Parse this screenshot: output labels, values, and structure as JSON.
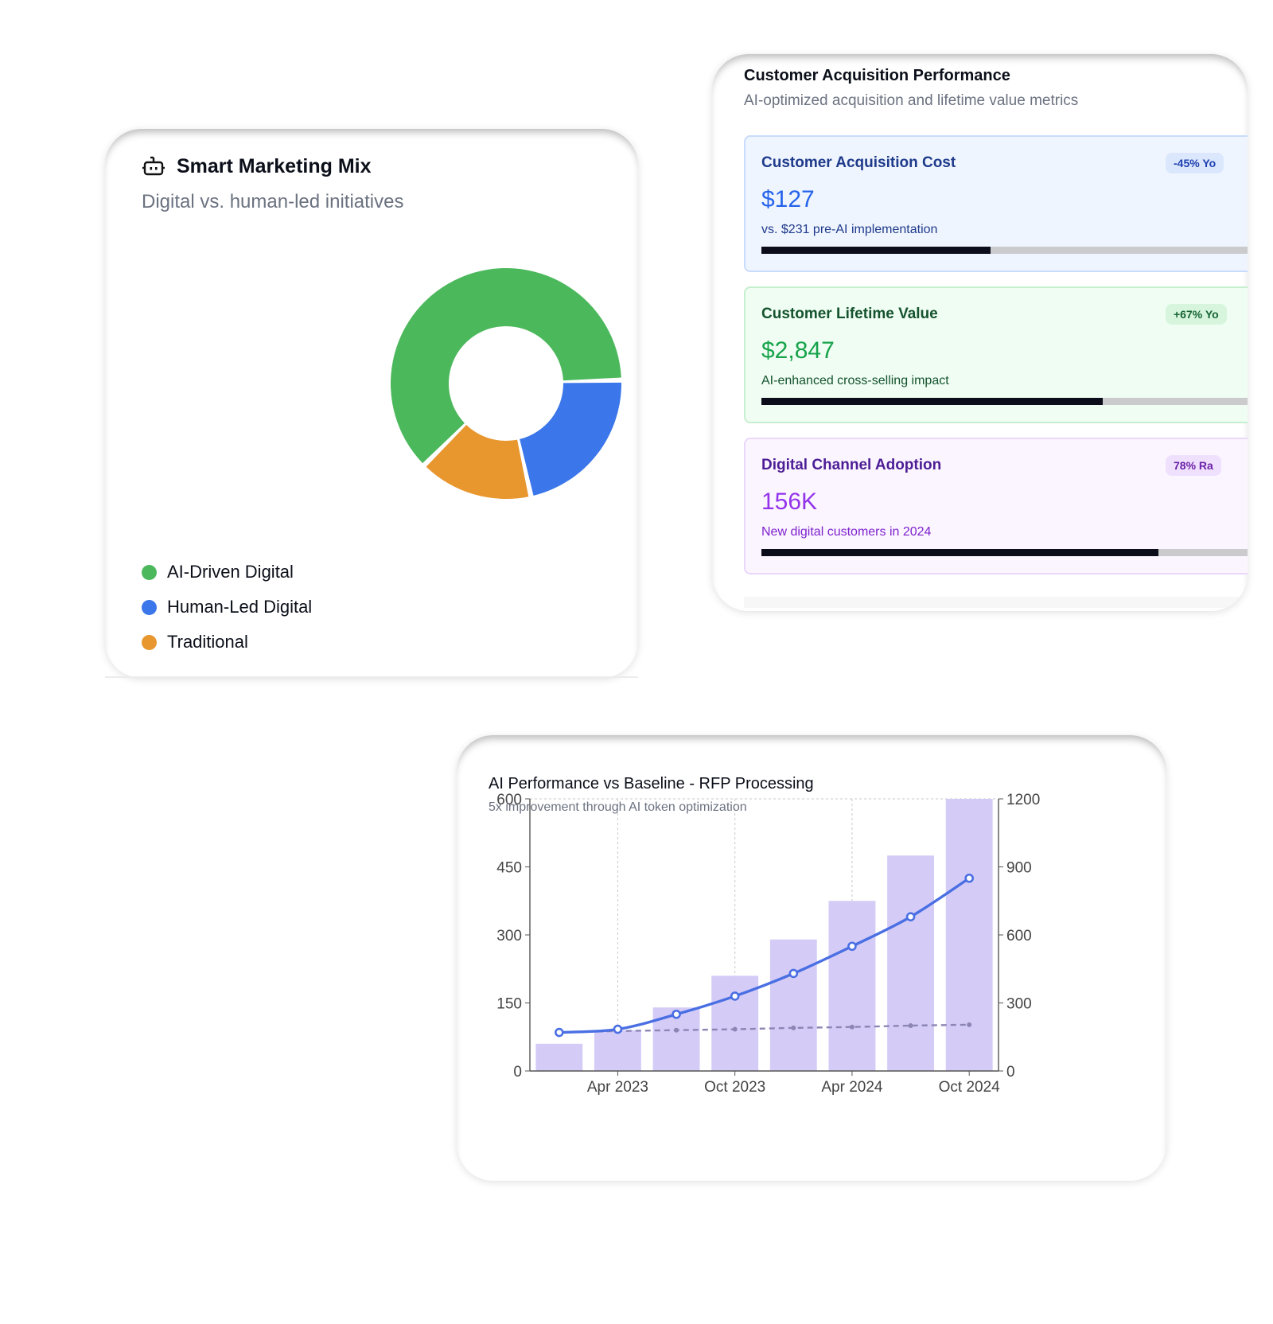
{
  "marketing_mix": {
    "title": "Smart Marketing Mix",
    "subtitle": "Digital vs. human-led initiatives",
    "icon": "robot-icon",
    "segments": [
      {
        "label": "AI-Driven Digital",
        "value": 62,
        "color": "#4cb85c"
      },
      {
        "label": "Human-Led Digital",
        "value": 22,
        "color": "#3b76ea"
      },
      {
        "label": "Traditional",
        "value": 16,
        "color": "#e8962e"
      }
    ]
  },
  "acquisition": {
    "title": "Customer Acquisition Performance",
    "subtitle": "AI-optimized acquisition and lifetime value metrics",
    "metrics": [
      {
        "label": "Customer Acquisition Cost",
        "badge": "-45% Yo",
        "value": "$127",
        "note": "vs. $231 pre-AI implementation",
        "progress": 0.45
      },
      {
        "label": "Customer Lifetime Value",
        "badge": "+67% Yo",
        "value": "$2,847",
        "note": "AI-enhanced cross-selling impact",
        "progress": 0.67
      },
      {
        "label": "Digital Channel Adoption",
        "badge": "78% Ra",
        "value": "156K",
        "note": "New digital customers in 2024",
        "progress": 0.78
      }
    ]
  },
  "performance": {
    "title": "AI Performance vs Baseline - RFP Processing",
    "subtitle": "5x improvement through AI token optimization"
  },
  "chart_data": {
    "type": "bar",
    "x_tick_labels": [
      "Apr 2023",
      "Oct 2023",
      "Apr 2024",
      "Oct 2024"
    ],
    "left_axis": {
      "min": 0,
      "max": 600,
      "ticks": [
        "0",
        "150",
        "300",
        "450",
        "600"
      ]
    },
    "right_axis": {
      "min": 0,
      "max": 1200,
      "ticks": [
        "0",
        "300",
        "600",
        "900",
        "1200"
      ]
    },
    "grid": "dashed",
    "series": [
      {
        "type": "bar",
        "axis": "right",
        "color": "#d4ccf7",
        "values": [
          120,
          180,
          280,
          420,
          580,
          750,
          950,
          1200
        ]
      },
      {
        "type": "line",
        "axis": "left",
        "color": "#4a6fe3",
        "values": [
          85,
          92,
          125,
          165,
          215,
          275,
          340,
          425
        ]
      },
      {
        "type": "line",
        "axis": "left",
        "style": "dashed",
        "color": "#8d86b5",
        "values": [
          85,
          88,
          90,
          92,
          95,
          97,
          100,
          102
        ]
      }
    ]
  }
}
